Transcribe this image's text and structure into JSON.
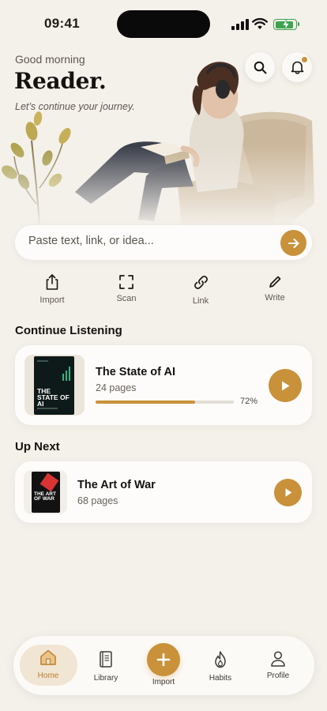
{
  "status": {
    "time": "09:41",
    "battery_color": "#3ea350"
  },
  "header": {
    "greeting": "Good morning",
    "title": "Reader.",
    "subtitle": "Let’s continue your journey.",
    "search_icon": "search-icon",
    "bell_icon": "bell-icon"
  },
  "input": {
    "placeholder": "Paste text, link, or idea...",
    "submit_icon": "arrow-right-icon"
  },
  "actions": [
    {
      "label": "Import",
      "icon": "share-upload-icon"
    },
    {
      "label": "Scan",
      "icon": "scan-frame-icon"
    },
    {
      "label": "Link",
      "icon": "link-icon"
    },
    {
      "label": "Write",
      "icon": "pen-icon"
    }
  ],
  "continue_listening": {
    "heading": "Continue Listening",
    "book": {
      "title": "The State of AI",
      "meta": "24 pages",
      "progress": 0.72,
      "progress_label": "72%",
      "cover_text": "THE STATE OF AI"
    }
  },
  "up_next": {
    "heading": "Up Next",
    "book": {
      "title": "The Art of War",
      "meta": "68 pages",
      "cover_text": "THE ART OF WAR"
    }
  },
  "nav": [
    {
      "label": "Home",
      "icon": "home-icon",
      "active": true
    },
    {
      "label": "Library",
      "icon": "book-icon"
    },
    {
      "label": "Import",
      "icon": "plus-icon"
    },
    {
      "label": "Habits",
      "icon": "flame-icon"
    },
    {
      "label": "Profile",
      "icon": "person-icon"
    }
  ],
  "colors": {
    "accent": "#c9913a",
    "background": "#f4f0ea",
    "card": "#fdfcfa"
  }
}
